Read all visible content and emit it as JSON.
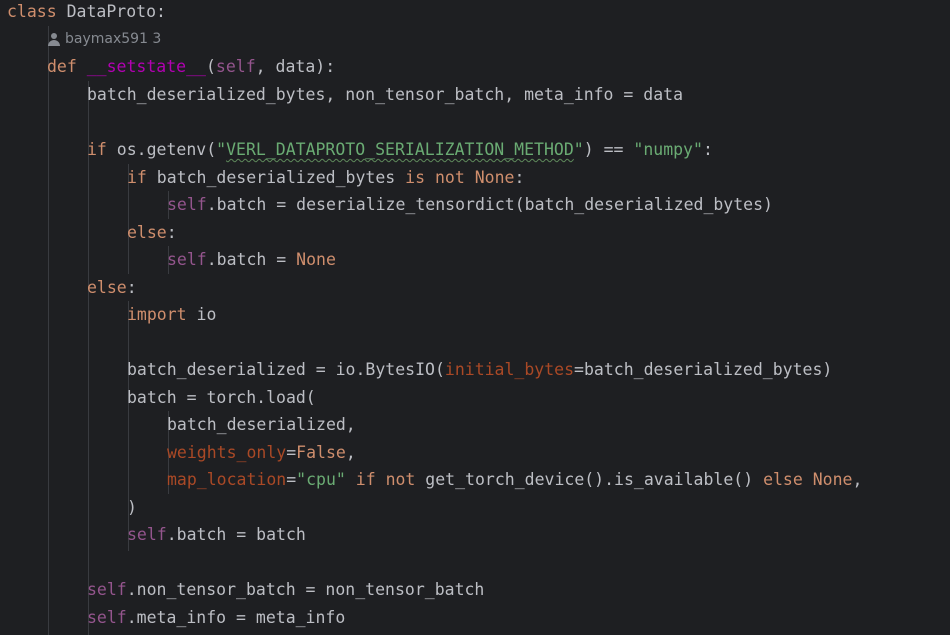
{
  "code": {
    "class_line": {
      "kw": "class",
      "name": "DataProto:"
    },
    "author_hint": {
      "icon": "user-icon",
      "text": "baymax591 3"
    },
    "def_line": {
      "kw": "def",
      "name": "__setstate__",
      "rest_open": "(",
      "self": "self",
      "rest": ", data):"
    },
    "l1": "batch_deserialized_bytes, non_tensor_batch, meta_info = data",
    "l2": {
      "kw": "if",
      "a": " os.getenv(",
      "str_open": "\"",
      "str_body": "VERL_DATAPROTO_SERIALIZATION_METHOD",
      "str_close": "\"",
      "b": ") == ",
      "str2": "\"numpy\"",
      "c": ":"
    },
    "l3": {
      "kw1": "if",
      "a": " batch_deserialized_bytes ",
      "kw2": "is not",
      "b": " ",
      "kw3": "None",
      "c": ":"
    },
    "l4": {
      "self": "self",
      "a": ".batch = deserialize_tensordict(batch_deserialized_bytes)"
    },
    "l5": {
      "kw": "else",
      "a": ":"
    },
    "l6": {
      "self": "self",
      "a": ".batch = ",
      "kw": "None"
    },
    "l7": {
      "kw": "else",
      "a": ":"
    },
    "l8": {
      "kw": "import",
      "a": " io"
    },
    "l9": {
      "a": "batch_deserialized = io.BytesIO(",
      "prm": "initial_bytes",
      "b": "=batch_deserialized_bytes)"
    },
    "l10": "batch = torch.load(",
    "l11": "batch_deserialized,",
    "l12": {
      "prm": "weights_only",
      "a": "=",
      "kw": "False",
      "b": ","
    },
    "l13": {
      "prm": "map_location",
      "a": "=",
      "str": "\"cpu\"",
      "b": " ",
      "kw1": "if not",
      "c": " get_torch_device().is_available() ",
      "kw2": "else",
      "d": " ",
      "kw3": "None",
      "e": ","
    },
    "l14": ")",
    "l15": {
      "self": "self",
      "a": ".batch = batch"
    },
    "l16": {
      "self": "self",
      "a": ".non_tensor_batch = non_tensor_batch"
    },
    "l17": {
      "self": "self",
      "a": ".meta_info = meta_info"
    }
  }
}
